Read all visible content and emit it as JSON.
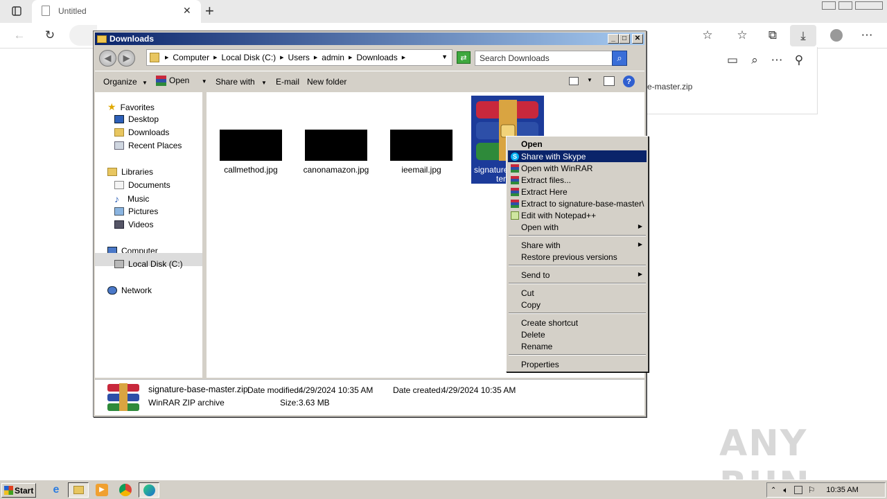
{
  "browser": {
    "tab_title": "Untitled",
    "downloads_file": "e-master.zip",
    "new_tab_symbol": "+"
  },
  "explorer": {
    "window_title": "Downloads",
    "breadcrumb": [
      "Computer",
      "Local Disk (C:)",
      "Users",
      "admin",
      "Downloads"
    ],
    "search_placeholder": "Search Downloads",
    "commands": {
      "organize": "Organize",
      "open": "Open",
      "share_with": "Share with",
      "email": "E-mail",
      "new_folder": "New folder"
    },
    "nav": {
      "favorites": "Favorites",
      "desktop": "Desktop",
      "downloads": "Downloads",
      "recent_places": "Recent Places",
      "libraries": "Libraries",
      "documents": "Documents",
      "music": "Music",
      "pictures": "Pictures",
      "videos": "Videos",
      "computer": "Computer",
      "local_disk": "Local Disk (C:)",
      "network": "Network"
    },
    "files": [
      {
        "name": "callmethod.jpg"
      },
      {
        "name": "canonamazon.jpg"
      },
      {
        "name": "ieemail.jpg"
      },
      {
        "name_line1": "signature",
        "name_line2": "ter"
      }
    ],
    "details": {
      "filename": "signature-base-master.zip",
      "type": "WinRAR ZIP archive",
      "date_modified_label": "Date modified:",
      "date_modified": "4/29/2024 10:35 AM",
      "date_created_label": "Date created:",
      "date_created": "4/29/2024 10:35 AM",
      "size_label": "Size:",
      "size": "3.63 MB"
    }
  },
  "context_menu": {
    "open": "Open",
    "share_skype": "Share with Skype",
    "open_winrar": "Open with WinRAR",
    "extract_files": "Extract files...",
    "extract_here": "Extract Here",
    "extract_to": "Extract to signature-base-master\\",
    "edit_notepad": "Edit with Notepad++",
    "open_with": "Open with",
    "share_with": "Share with",
    "restore": "Restore previous versions",
    "send_to": "Send to",
    "cut": "Cut",
    "copy": "Copy",
    "create_shortcut": "Create shortcut",
    "delete": "Delete",
    "rename": "Rename",
    "properties": "Properties"
  },
  "taskbar": {
    "start": "Start",
    "clock": "10:35 AM"
  },
  "watermark": "ANY RUN",
  "colors": {
    "title_active": "#0a246a",
    "menu_highlight": "#0a246a",
    "classic_face": "#d4d0c8",
    "winrar_red": "#c8283c",
    "winrar_blue": "#2d4fa8",
    "winrar_green": "#2e8a3a",
    "selection_blue": "#1c3b9a"
  }
}
